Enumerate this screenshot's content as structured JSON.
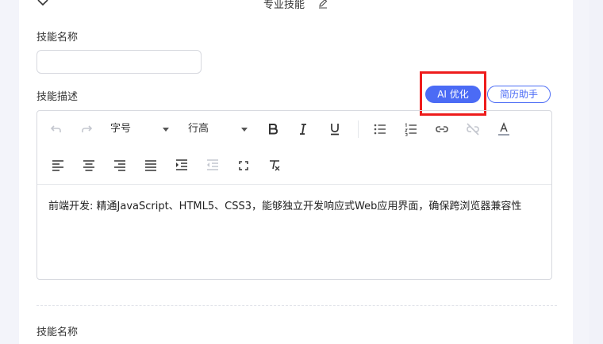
{
  "section": {
    "title": "专业技能"
  },
  "form": {
    "skill_name_label": "技能名称",
    "skill_name_value": "",
    "skill_desc_label": "技能描述",
    "ai_optimize_label": "AI 优化",
    "resume_helper_label": "简历助手",
    "next_skill_name_label": "技能名称"
  },
  "toolbar": {
    "font_size_label": "字号",
    "line_height_label": "行高"
  },
  "editor": {
    "content": "前端开发: 精通JavaScript、HTML5、CSS3，能够独立开发响应式Web应用界面，确保跨浏览器兼容性"
  },
  "colors": {
    "accent": "#4b6bf5",
    "highlight": "#ee1c1c"
  }
}
